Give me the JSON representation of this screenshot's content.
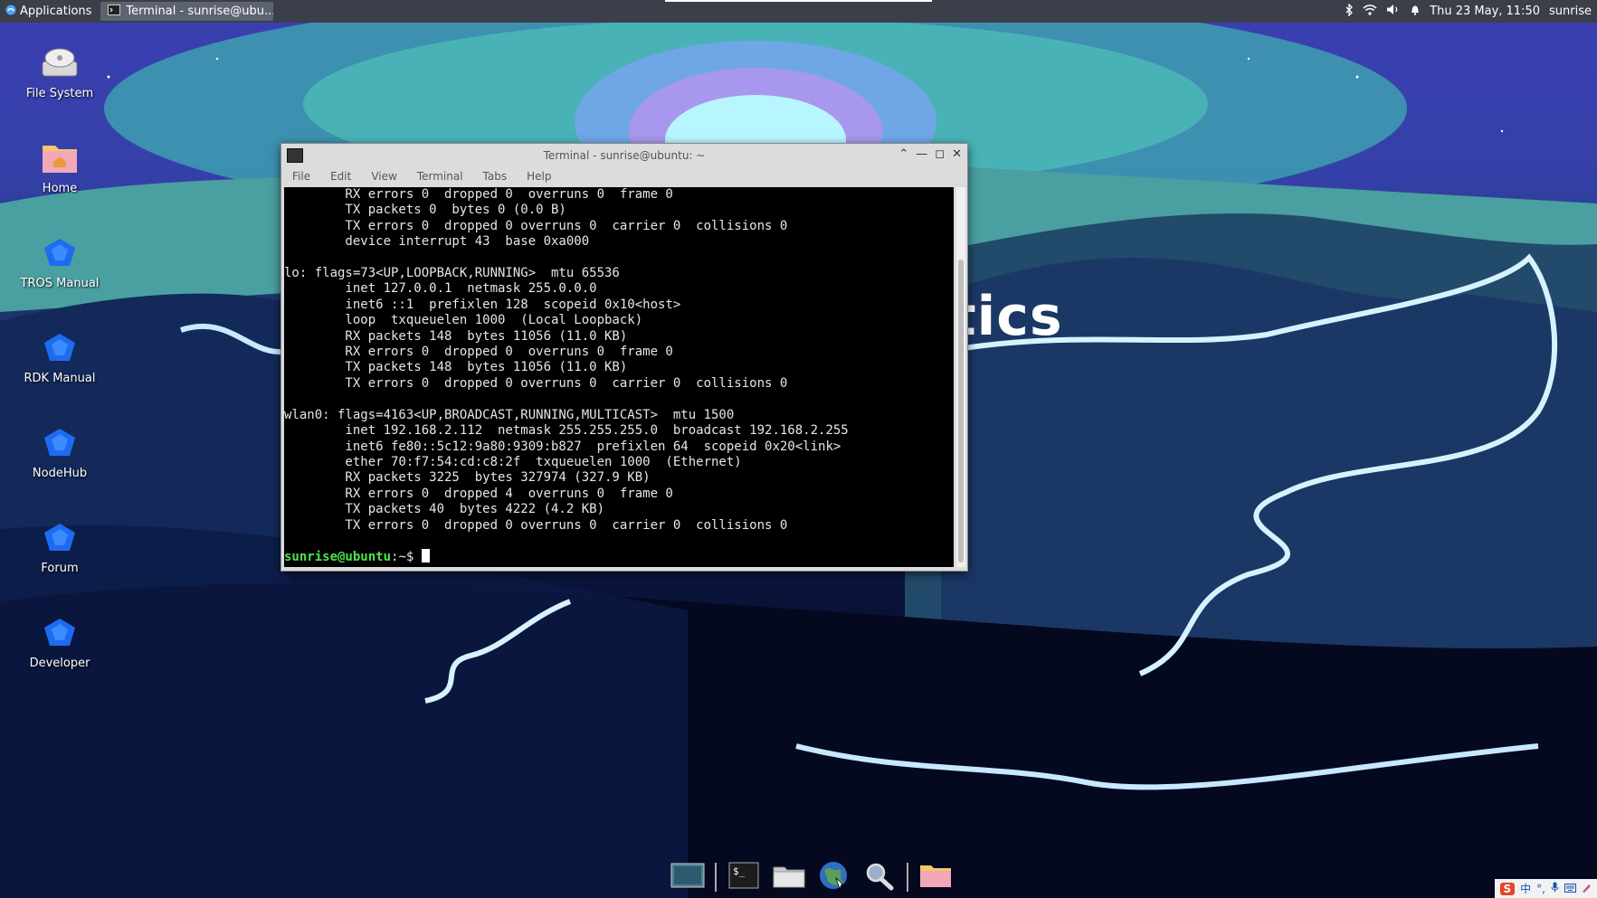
{
  "top_panel": {
    "applications_label": "Applications",
    "task_title": "Terminal - sunrise@ubu...",
    "datetime": "Thu 23 May, 11:50",
    "user": "sunrise"
  },
  "wallpaper": {
    "text": "tics"
  },
  "desktop_icons": [
    {
      "label": "File System",
      "icon": "drive-icon"
    },
    {
      "label": "Home",
      "icon": "home-folder-icon"
    },
    {
      "label": "TROS Manual",
      "icon": "tros-manual-icon"
    },
    {
      "label": "RDK Manual",
      "icon": "rdk-manual-icon"
    },
    {
      "label": "NodeHub",
      "icon": "nodehub-icon"
    },
    {
      "label": "Forum",
      "icon": "forum-icon"
    },
    {
      "label": "Developer",
      "icon": "developer-icon"
    }
  ],
  "terminal": {
    "title": "Terminal - sunrise@ubuntu: ~",
    "menu": [
      "File",
      "Edit",
      "View",
      "Terminal",
      "Tabs",
      "Help"
    ],
    "lines": [
      "        RX errors 0  dropped 0  overruns 0  frame 0",
      "        TX packets 0  bytes 0 (0.0 B)",
      "        TX errors 0  dropped 0 overruns 0  carrier 0  collisions 0",
      "        device interrupt 43  base 0xa000",
      "",
      "lo: flags=73<UP,LOOPBACK,RUNNING>  mtu 65536",
      "        inet 127.0.0.1  netmask 255.0.0.0",
      "        inet6 ::1  prefixlen 128  scopeid 0x10<host>",
      "        loop  txqueuelen 1000  (Local Loopback)",
      "        RX packets 148  bytes 11056 (11.0 KB)",
      "        RX errors 0  dropped 0  overruns 0  frame 0",
      "        TX packets 148  bytes 11056 (11.0 KB)",
      "        TX errors 0  dropped 0 overruns 0  carrier 0  collisions 0",
      "",
      "wlan0: flags=4163<UP,BROADCAST,RUNNING,MULTICAST>  mtu 1500",
      "        inet 192.168.2.112  netmask 255.255.255.0  broadcast 192.168.2.255",
      "        inet6 fe80::5c12:9a80:9309:b827  prefixlen 64  scopeid 0x20<link>",
      "        ether 70:f7:54:cd:c8:2f  txqueuelen 1000  (Ethernet)",
      "        RX packets 3225  bytes 327974 (327.9 KB)",
      "        RX errors 0  dropped 4  overruns 0  frame 0",
      "        TX packets 40  bytes 4222 (4.2 KB)",
      "        TX errors 0  dropped 0 overruns 0  carrier 0  collisions 0",
      ""
    ],
    "prompt_user": "sunrise@ubuntu",
    "prompt_rest": ":~$ "
  },
  "dock": [
    "show-desktop-icon",
    "terminal-icon",
    "file-manager-icon",
    "web-browser-icon",
    "app-finder-icon",
    "folder-icon"
  ],
  "ime": {
    "logo": "S",
    "mode": "中"
  }
}
